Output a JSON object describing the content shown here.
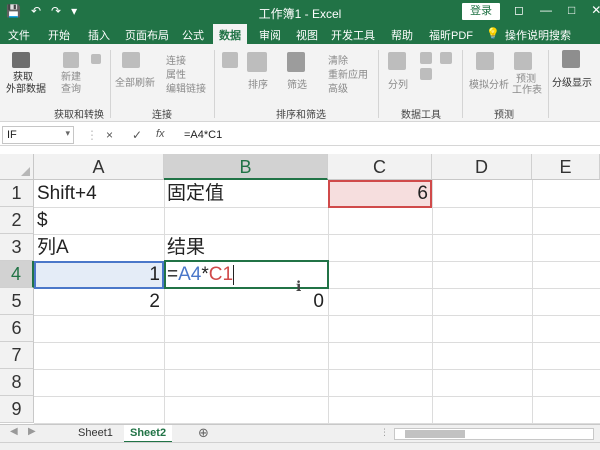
{
  "window": {
    "title": "工作簿1 - Excel",
    "login_label": "登录",
    "quick_access": [
      "save-icon",
      "undo-icon",
      "redo-icon",
      "customize-icon"
    ],
    "controls": [
      "restore-icon",
      "minimize-icon",
      "maximize-icon",
      "close-icon"
    ]
  },
  "ribbon": {
    "tabs": [
      "文件",
      "开始",
      "插入",
      "页面布局",
      "公式",
      "数据",
      "审阅",
      "视图",
      "开发工具",
      "帮助",
      "福昕PDF",
      "操作说明搜索"
    ],
    "active_tab": "数据",
    "groups": {
      "get_transform": {
        "label": "获取和转换",
        "items": [
          "获取\n外部数据",
          "新建\n查询",
          "显示查询"
        ]
      },
      "connections": {
        "label": "连接",
        "items": [
          "全部刷新",
          "连接",
          "属性",
          "编辑链接"
        ]
      },
      "sort_filter": {
        "label": "排序和筛选",
        "items": [
          "排序",
          "筛选",
          "清除",
          "重新应用",
          "高级"
        ]
      },
      "data_tools": {
        "label": "数据工具",
        "items": [
          "分列"
        ]
      },
      "forecast": {
        "label": "预测",
        "items": [
          "模拟分析",
          "预测\n工作表"
        ]
      },
      "outline": {
        "label": "",
        "items": [
          "分级显示"
        ]
      }
    }
  },
  "formula_bar": {
    "name_box": "IF",
    "cancel": "×",
    "enter": "✓",
    "fx": "fx",
    "content": "=A4*C1"
  },
  "sheet": {
    "columns": [
      "A",
      "B",
      "C",
      "D",
      "E"
    ],
    "rows": [
      "1",
      "2",
      "3",
      "4",
      "5",
      "6",
      "7",
      "8",
      "9"
    ],
    "selected_column": "B",
    "selected_row": "4",
    "cells": {
      "A1": "Shift+4",
      "B1": "固定值",
      "C1": "6",
      "A2": "$",
      "A3": "列A",
      "B3": "结果",
      "A4": "1",
      "A5": "2",
      "B5": "0",
      "B4_editing": {
        "prefix": "=",
        "ref1": "A4",
        "op": "*",
        "ref2": "C1"
      }
    },
    "highlight_colors": {
      "A4_ref": "#4a77c9",
      "C1_ref": "#d04a4a",
      "active": "#217346"
    }
  },
  "sheet_tabs": {
    "tabs": [
      "Sheet1",
      "Sheet2"
    ],
    "active": "Sheet2",
    "add": "⊕"
  }
}
